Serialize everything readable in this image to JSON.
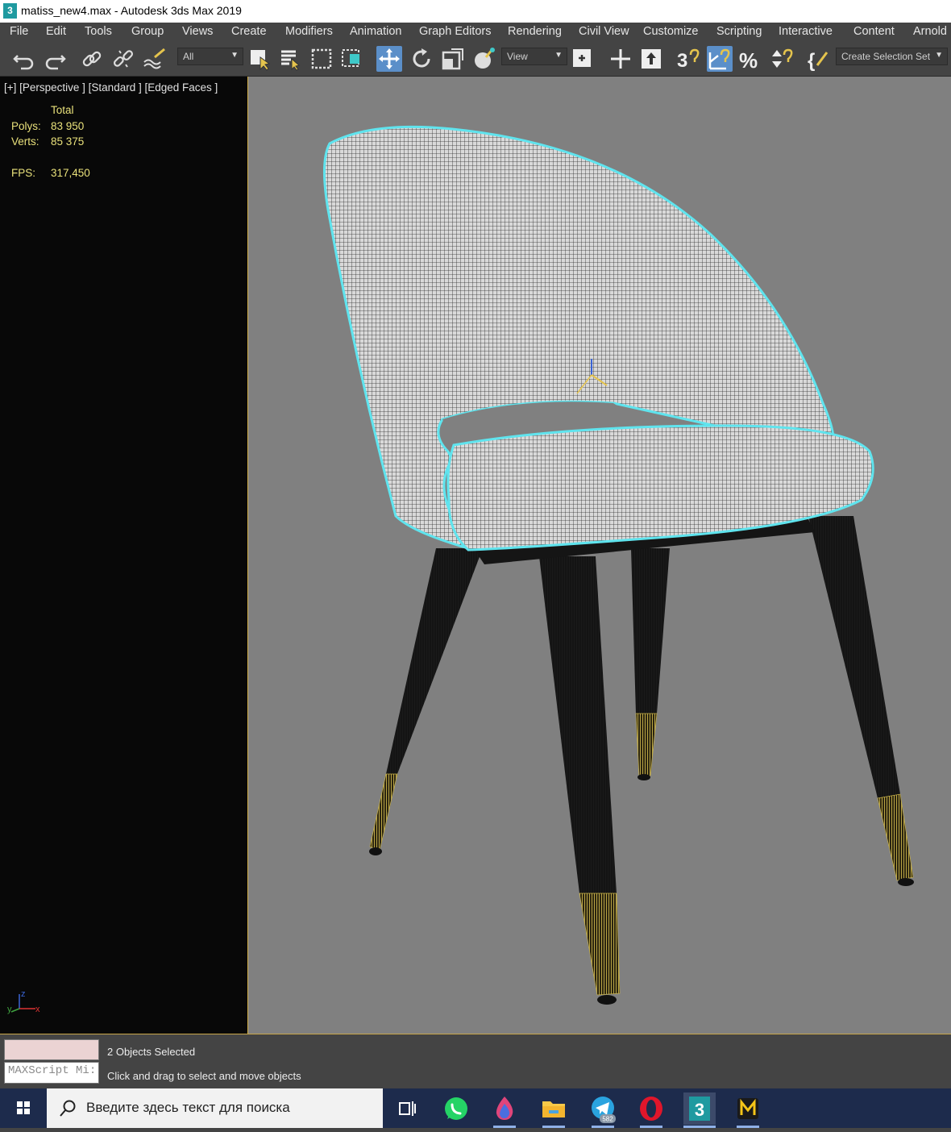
{
  "window": {
    "app_icon": "3",
    "title": "matiss_new4.max - Autodesk 3ds Max 2019"
  },
  "menu": {
    "items": [
      "File",
      "Edit",
      "Tools",
      "Group",
      "Views",
      "Create",
      "Modifiers",
      "Animation",
      "Graph Editors",
      "Rendering",
      "Civil View",
      "Customize",
      "Scripting",
      "Interactive",
      "Content",
      "Arnold"
    ]
  },
  "toolbar": {
    "selection_filter": "All",
    "reference_coord": "View",
    "selection_set_placeholder": "Create Selection Set",
    "icons": [
      "undo-icon",
      "redo-icon",
      "select-and-link-icon",
      "unlink-icon",
      "bind-to-space-warp-icon",
      "select-object-icon",
      "select-by-name-icon",
      "rectangular-selection-icon",
      "window-crossing-icon",
      "select-and-move-icon",
      "select-and-rotate-icon",
      "select-and-scale-icon",
      "select-and-place-icon",
      "use-pivot-point-icon",
      "select-manipulate-icon",
      "keyboard-shortcut-override-icon",
      "snaps-toggle-icon",
      "angle-snap-icon",
      "percent-snap-icon",
      "spinner-snap-icon",
      "edit-named-selection-icon"
    ]
  },
  "viewport": {
    "label": "[+] [Perspective ] [Standard ] [Edged Faces ]",
    "stats": {
      "header": "Total",
      "polys_label": "Polys:",
      "polys_value": "83 950",
      "verts_label": "Verts:",
      "verts_value": "85 375",
      "fps_label": "FPS:",
      "fps_value": "317,450"
    },
    "axis_labels": {
      "x": "x",
      "y": "y",
      "z": "z"
    },
    "accent_selection": "#5fe4ee",
    "accent_border": "#d4b24a"
  },
  "status": {
    "maxscript_placeholder": "MAXScript Mi:",
    "selection_info": "2 Objects Selected",
    "prompt": "Click and drag to select and move objects"
  },
  "taskbar": {
    "search_placeholder": "Введите здесь текст для поиска",
    "telegram_badge": "582",
    "apps": [
      "task-view-icon",
      "whatsapp-icon",
      "flame-app-icon",
      "file-explorer-icon",
      "telegram-icon",
      "opera-icon",
      "3ds-max-icon",
      "miro-icon"
    ]
  }
}
